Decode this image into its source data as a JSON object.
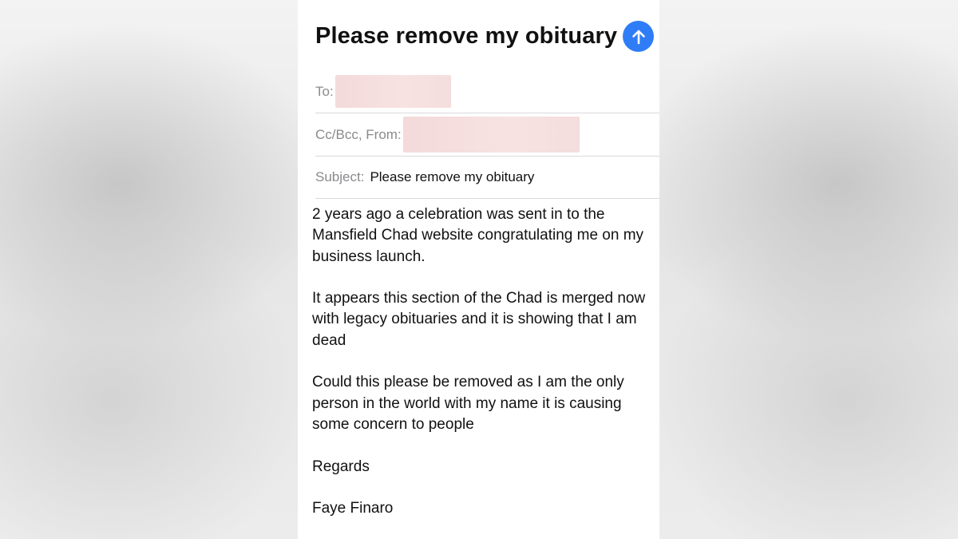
{
  "compose": {
    "subject_title": "Please remove my obituary",
    "to_label": "To:",
    "cc_from_label": "Cc/Bcc, From:",
    "subject_label": "Subject:",
    "subject_value": "Please remove my obituary",
    "send_icon": "arrow-up-icon",
    "accent_color": "#2f7df6"
  },
  "body": {
    "paragraphs": [
      "2 years ago a celebration was sent in to the\nMansfield Chad website congratulating me on my\nbusiness launch.",
      "It appears this section of the Chad is merged now\nwith legacy obituaries and it is showing that I am\ndead",
      "Could this please be removed as I am the only\nperson in the world with my name it is causing\nsome concern to people",
      "Regards",
      "Faye Finaro"
    ]
  }
}
